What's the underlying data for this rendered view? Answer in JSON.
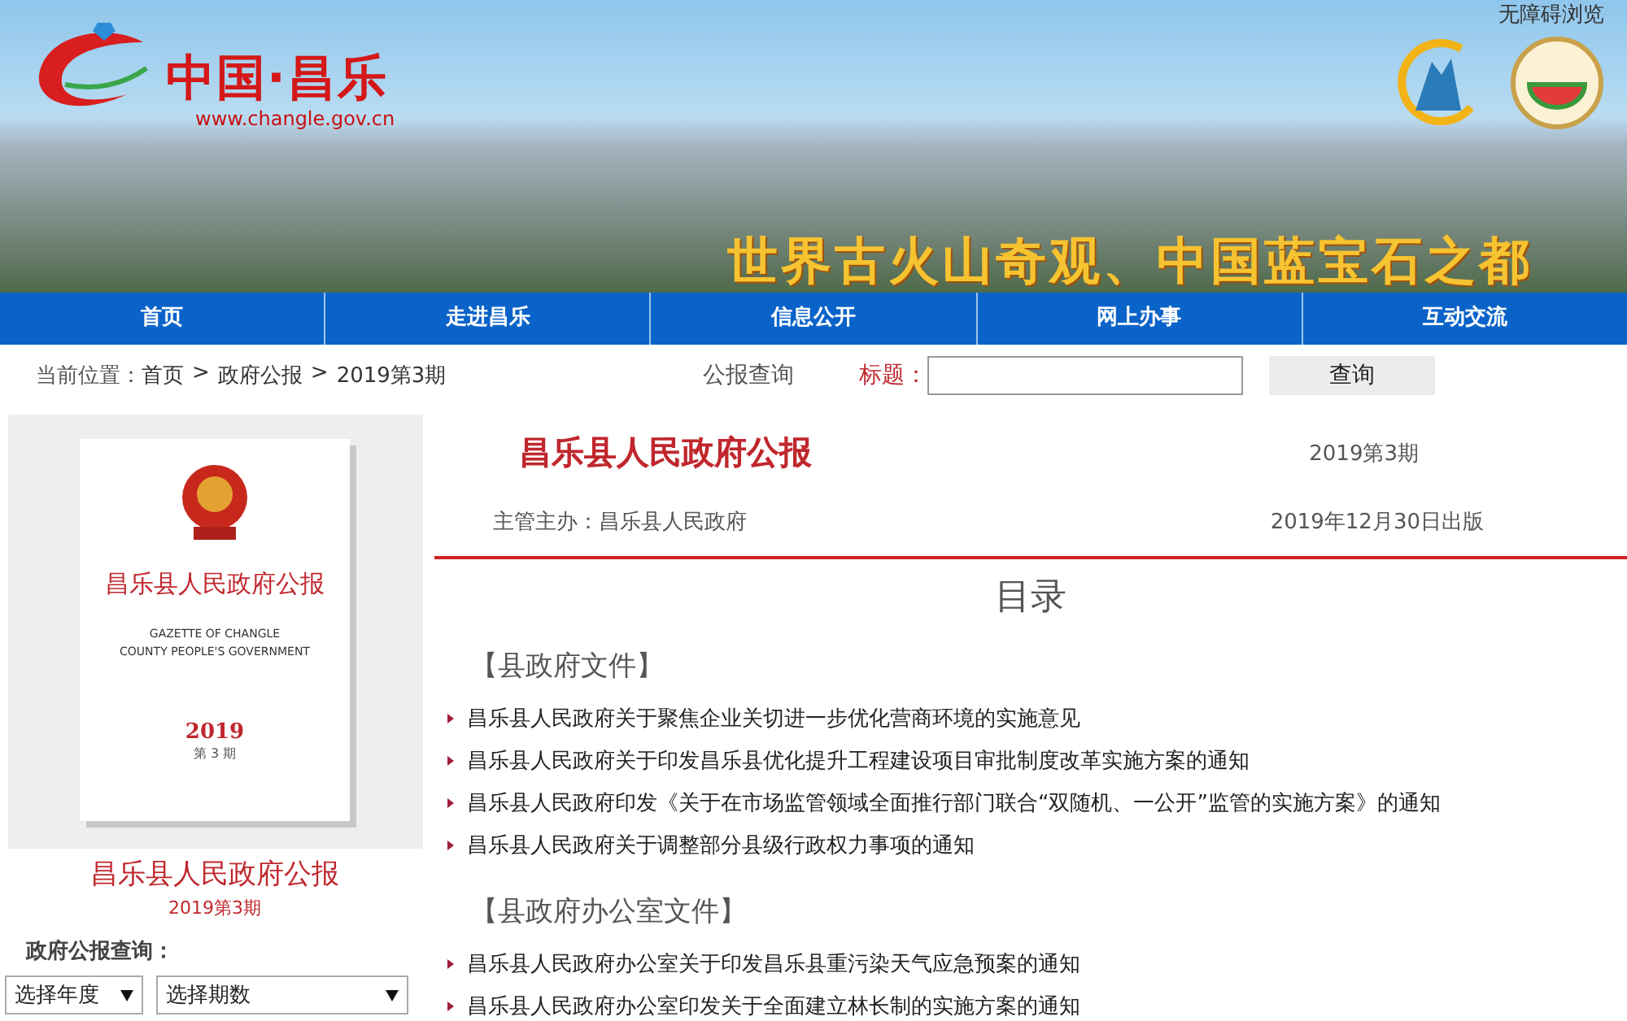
{
  "header": {
    "accessibility_link": "无障碍浏览",
    "logo_title": "中国·昌乐",
    "logo_url": "www.changle.gov.cn",
    "slogan": "世界古火山奇观、中国蓝宝石之都"
  },
  "nav": [
    {
      "label": "首页"
    },
    {
      "label": "走进昌乐"
    },
    {
      "label": "信息公开"
    },
    {
      "label": "网上办事"
    },
    {
      "label": "互动交流"
    }
  ],
  "breadcrumb": {
    "prefix": "当前位置：",
    "items": [
      "首页",
      "政府公报",
      "2019第3期"
    ],
    "separator": ">"
  },
  "search": {
    "heading": "公报查询",
    "field_label": "标题：",
    "button": "查询"
  },
  "cover": {
    "title": "昌乐县人民政府公报",
    "subtitle_line1": "GAZETTE OF CHANGLE",
    "subtitle_line2": "COUNTY PEOPLE'S GOVERNMENT",
    "year": "2019",
    "issue": "第 3 期"
  },
  "sidebar": {
    "title": "昌乐县人民政府公报",
    "issue": "2019第3期",
    "query_label": "政府公报查询：",
    "selects": [
      "选择年度",
      "选择期数"
    ]
  },
  "gazette": {
    "title": "昌乐县人民政府公报",
    "issue": "2019第3期",
    "publisher": "主管主办：昌乐县人民政府",
    "date": "2019年12月30日出版",
    "toc_title": "目录"
  },
  "sections": [
    {
      "heading": "【县政府文件】",
      "items": [
        "昌乐县人民政府关于聚焦企业关切进一步优化营商环境的实施意见",
        "昌乐县人民政府关于印发昌乐县优化提升工程建设项目审批制度改革实施方案的通知",
        "昌乐县人民政府印发《关于在市场监管领域全面推行部门联合“双随机、一公开”监管的实施方案》的通知",
        "昌乐县人民政府关于调整部分县级行政权力事项的通知"
      ]
    },
    {
      "heading": "【县政府办公室文件】",
      "items": [
        "昌乐县人民政府办公室关于印发昌乐县重污染天气应急预案的通知",
        "昌乐县人民政府办公室印发关于全面建立林长制的实施方案的通知"
      ]
    }
  ]
}
